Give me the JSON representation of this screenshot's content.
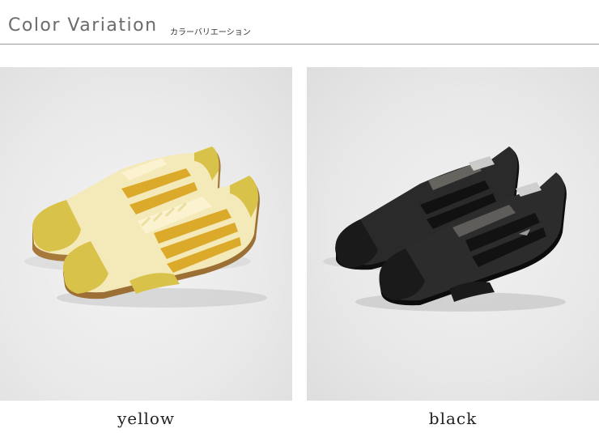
{
  "header": {
    "title": "Color Variation",
    "subtitle": "カラーバリエーション"
  },
  "variations": [
    {
      "label": "yellow",
      "upper_color": "#f4e9b8",
      "stripe_color": "#dcaa2a",
      "suede_color": "#d9c24a",
      "sole_color": "#8a6a3a"
    },
    {
      "label": "black",
      "upper_color": "#2a2a2a",
      "stripe_color": "#111111",
      "suede_color": "#1a1a1a",
      "sole_color": "#0c0c0c"
    }
  ]
}
